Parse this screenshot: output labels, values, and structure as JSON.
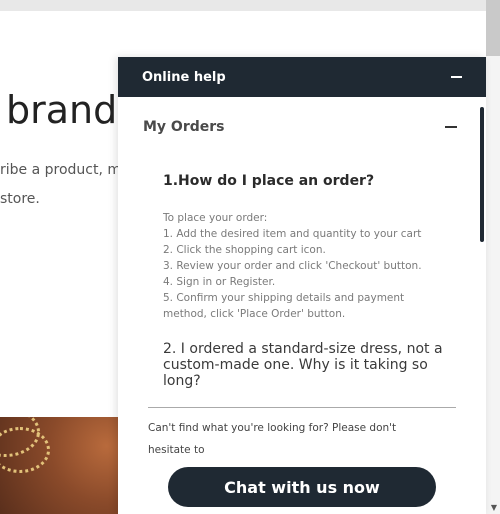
{
  "page": {
    "brand_heading": "brand",
    "hero_line1": "ribe a product, m",
    "hero_line2": "store."
  },
  "help_widget": {
    "title": "Online help",
    "section_title": "My Orders",
    "faq": [
      {
        "question": "1.How do I place an order?",
        "answer": [
          "To place your order:",
          "1. Add the desired item and quantity to your cart",
          "2. Click the shopping cart icon.",
          "3. Review your order and click 'Checkout' button.",
          "4. Sign in or Register.",
          "5. Confirm your shipping details and payment method, click 'Place Order' button."
        ]
      },
      {
        "question": "2. I ordered a standard-size dress, not a custom-made one. Why is it taking so long?"
      }
    ],
    "footer_text": "Can't find what you're looking for? Please don't hesitate to",
    "chat_button": "Chat with us now"
  },
  "icons": {
    "minimize": "minus-icon",
    "collapse": "minus-icon",
    "scroll_down": "triangle-down-icon"
  },
  "colors": {
    "widget_dark": "#1f2933",
    "white": "#ffffff"
  }
}
